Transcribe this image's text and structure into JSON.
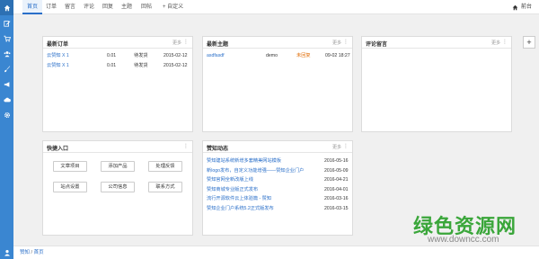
{
  "nav": {
    "tabs": [
      "首页",
      "订单",
      "留言",
      "评论",
      "回复",
      "主题",
      "回帖"
    ],
    "add_label": "+ 自定义",
    "front_label": "前台"
  },
  "panels": {
    "orders": {
      "title": "最新订单",
      "more": "更多",
      "rows": [
        {
          "name": "云赞知 X 1",
          "price": "0.01",
          "status": "待发货",
          "date": "2015-02-12"
        },
        {
          "name": "云赞知 X 1",
          "price": "0.01",
          "status": "待发货",
          "date": "2015-02-12"
        }
      ]
    },
    "topics": {
      "title": "最新主题",
      "more": "更多",
      "rows": [
        {
          "title": "asdfasdf",
          "user": "demo",
          "status": "未回复",
          "date": "09-02 18:27"
        }
      ]
    },
    "comments": {
      "title": "评论留言",
      "more": "更多"
    },
    "quick": {
      "title": "快捷入口",
      "buttons": [
        "文章项目",
        "添加产品",
        "处理反馈",
        "站点设置",
        "公司信息",
        "联系方式"
      ]
    },
    "news": {
      "title": "赞知动态",
      "more": "更多",
      "rows": [
        {
          "title": "赞知建站系统新增多套精美网站模板",
          "date": "2016-05-16"
        },
        {
          "title": "新logo发布，自定义功能增强——赞知企业门户",
          "date": "2016-05-09"
        },
        {
          "title": "赞知官网全新改版上线",
          "date": "2016-04-21"
        },
        {
          "title": "赞知商城专业版正式发布",
          "date": "2016-04-01"
        },
        {
          "title": "流行开源软件云上体验篇 - 赞知",
          "date": "2016-03-16"
        },
        {
          "title": "赞知企业门户系统5.2正式版发布",
          "date": "2016-03-15"
        }
      ]
    }
  },
  "footer": {
    "crumb1": "赞知",
    "sep": " / ",
    "crumb2": "首页"
  },
  "watermark": {
    "cn": "绿色资源网",
    "url": "www.downcc.com"
  }
}
